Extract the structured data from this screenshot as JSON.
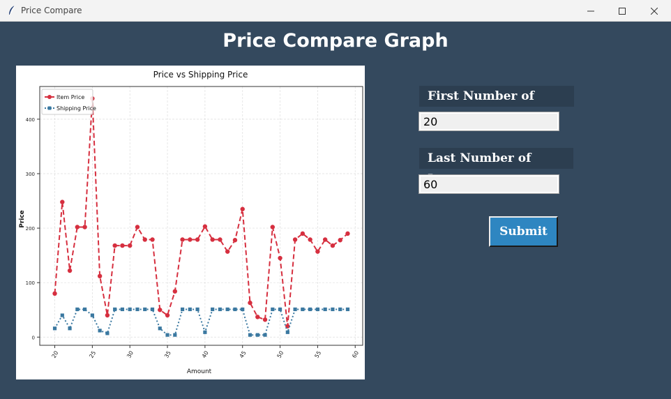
{
  "window": {
    "title": "Price Compare"
  },
  "page": {
    "heading": "Price Compare Graph"
  },
  "form": {
    "first_label": "First Number of Items:",
    "first_value": "20",
    "last_label": "Last Number of Items:",
    "last_value": "60",
    "submit_label": "Submit"
  },
  "colors": {
    "background": "#34495e",
    "label_bg": "#2c3e50",
    "submit": "#2e86c1",
    "item_price": "#d62f3f",
    "shipping_price": "#3a78a0"
  },
  "chart_data": {
    "type": "line",
    "title": "Price vs Shipping Price",
    "xlabel": "Amount",
    "ylabel": "Price",
    "xlim": [
      18,
      61
    ],
    "ylim": [
      -15,
      460
    ],
    "xticks": [
      20,
      25,
      30,
      35,
      40,
      45,
      50,
      55,
      60
    ],
    "yticks": [
      0,
      100,
      200,
      300,
      400
    ],
    "grid": true,
    "legend_position": "top-left",
    "x": [
      20,
      21,
      22,
      23,
      24,
      25,
      26,
      27,
      28,
      29,
      30,
      31,
      32,
      33,
      34,
      35,
      36,
      37,
      38,
      39,
      40,
      41,
      42,
      43,
      44,
      45,
      46,
      47,
      48,
      49,
      50,
      51,
      52,
      53,
      54,
      55,
      56,
      57,
      58,
      59
    ],
    "series": [
      {
        "name": "Item Price",
        "color": "#d62f3f",
        "style": "dashed",
        "marker": "circle",
        "values": [
          80,
          248,
          122,
          202,
          202,
          438,
          112,
          40,
          168,
          168,
          168,
          202,
          179,
          179,
          50,
          40,
          84,
          179,
          179,
          179,
          203,
          179,
          179,
          157,
          178,
          235,
          63,
          37,
          32,
          202,
          145,
          20,
          179,
          190,
          179,
          157,
          179,
          168,
          178,
          190
        ]
      },
      {
        "name": "Shipping Price",
        "color": "#3a78a0",
        "style": "dotted",
        "marker": "square",
        "values": [
          16,
          40,
          16,
          51,
          51,
          40,
          12,
          7,
          51,
          51,
          51,
          51,
          51,
          51,
          16,
          4,
          4,
          51,
          51,
          51,
          9,
          51,
          51,
          51,
          51,
          51,
          4,
          4,
          4,
          51,
          51,
          9,
          51,
          51,
          51,
          51,
          51,
          51,
          51,
          51
        ]
      }
    ]
  }
}
